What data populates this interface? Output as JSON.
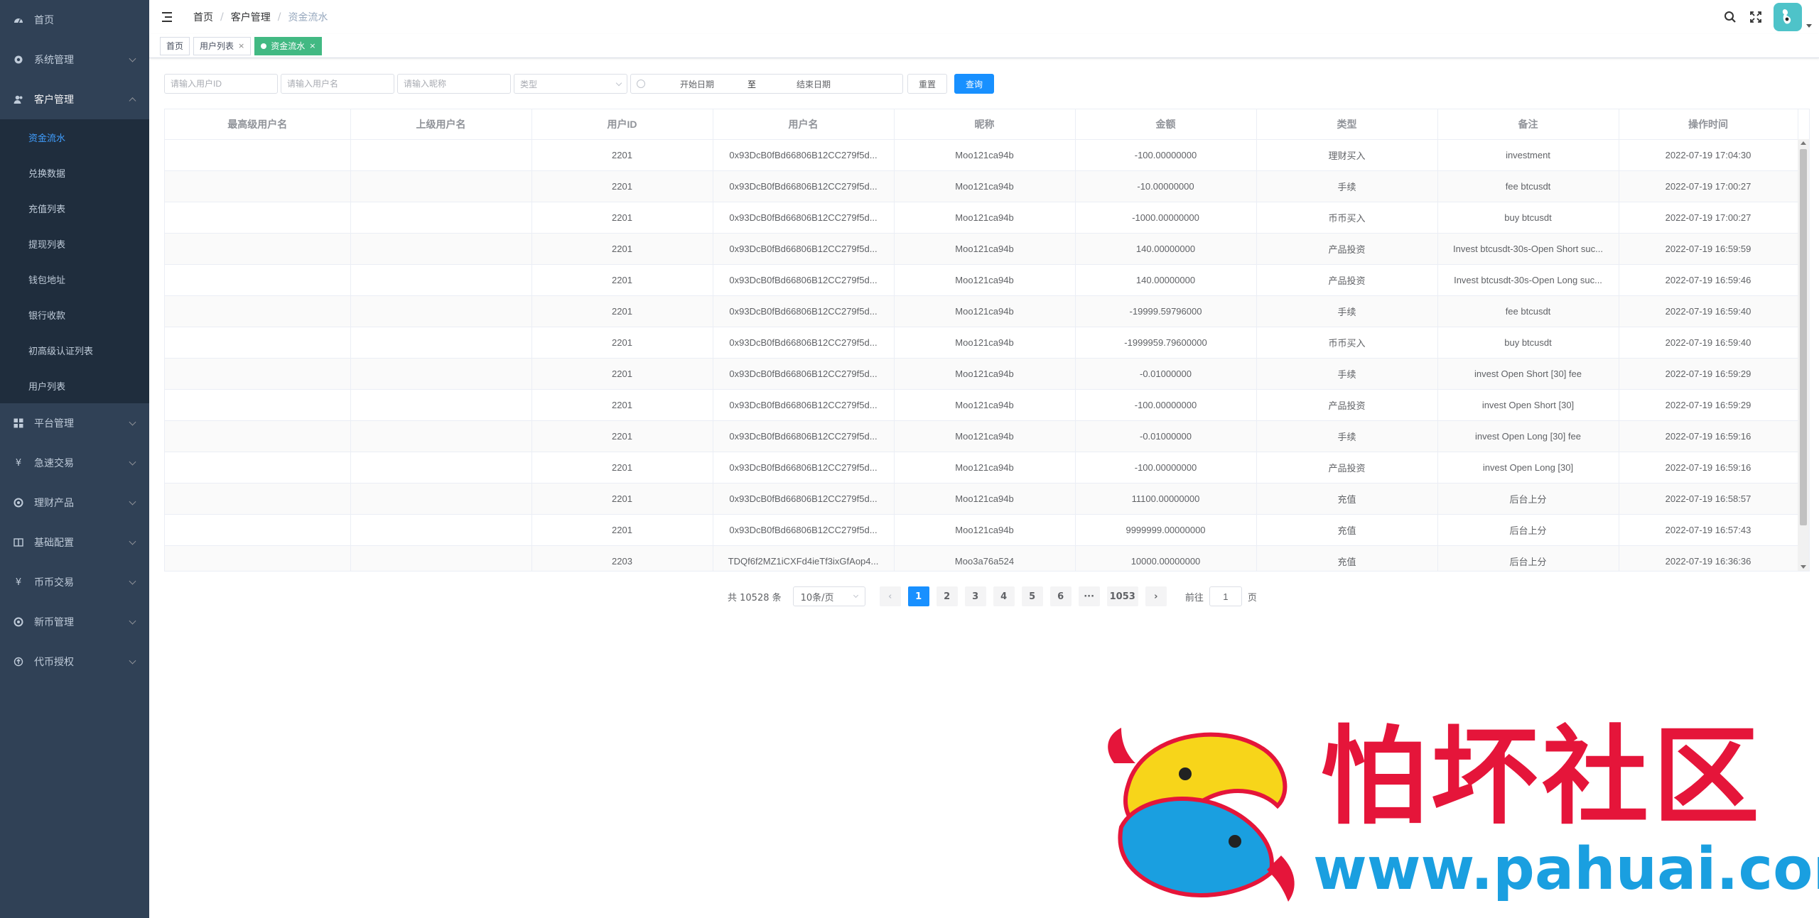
{
  "sidebar": {
    "items": [
      {
        "label": "首页",
        "icon": "dashboard-icon"
      },
      {
        "label": "系统管理",
        "icon": "gear-icon"
      },
      {
        "label": "客户管理",
        "icon": "users-icon"
      },
      {
        "label": "平台管理",
        "icon": "grid-icon"
      },
      {
        "label": "急速交易",
        "icon": "yen-icon"
      },
      {
        "label": "理财产品",
        "icon": "target-icon"
      },
      {
        "label": "基础配置",
        "icon": "book-icon"
      },
      {
        "label": "币币交易",
        "icon": "yen-icon"
      },
      {
        "label": "新币管理",
        "icon": "target-icon"
      },
      {
        "label": "代币授权",
        "icon": "circle-up-icon"
      }
    ],
    "submenu": [
      "资金流水",
      "兑换数据",
      "充值列表",
      "提现列表",
      "钱包地址",
      "银行收款",
      "初高级认证列表",
      "用户列表"
    ]
  },
  "navbar": {
    "breadcrumb": [
      "首页",
      "客户管理",
      "资金流水"
    ],
    "breadcrumb_sep": "/"
  },
  "tags": [
    {
      "label": "首页"
    },
    {
      "label": "用户列表"
    },
    {
      "label": "资金流水"
    }
  ],
  "tag_close": "×",
  "filters": {
    "user_id_placeholder": "请输入用户ID",
    "username_placeholder": "请输入用户名",
    "nickname_placeholder": "请输入昵称",
    "type_placeholder": "类型",
    "start_date": "开始日期",
    "date_sep": "至",
    "end_date": "结束日期",
    "reset_label": "重置",
    "query_label": "查询"
  },
  "table": {
    "columns": [
      "最高级用户名",
      "上级用户名",
      "用户ID",
      "用户名",
      "昵称",
      "金额",
      "类型",
      "备注",
      "操作时间"
    ],
    "rows": [
      [
        "",
        "",
        "2201",
        "0x93DcB0fBd66806B12CC279f5d...",
        "Moo121ca94b",
        "-100.00000000",
        "理财买入",
        "investment",
        "2022-07-19 17:04:30"
      ],
      [
        "",
        "",
        "2201",
        "0x93DcB0fBd66806B12CC279f5d...",
        "Moo121ca94b",
        "-10.00000000",
        "手续",
        "fee btcusdt",
        "2022-07-19 17:00:27"
      ],
      [
        "",
        "",
        "2201",
        "0x93DcB0fBd66806B12CC279f5d...",
        "Moo121ca94b",
        "-1000.00000000",
        "币币买入",
        "buy btcusdt",
        "2022-07-19 17:00:27"
      ],
      [
        "",
        "",
        "2201",
        "0x93DcB0fBd66806B12CC279f5d...",
        "Moo121ca94b",
        "140.00000000",
        "产品投资",
        "Invest btcusdt-30s-Open Short suc...",
        "2022-07-19 16:59:59"
      ],
      [
        "",
        "",
        "2201",
        "0x93DcB0fBd66806B12CC279f5d...",
        "Moo121ca94b",
        "140.00000000",
        "产品投资",
        "Invest btcusdt-30s-Open Long suc...",
        "2022-07-19 16:59:46"
      ],
      [
        "",
        "",
        "2201",
        "0x93DcB0fBd66806B12CC279f5d...",
        "Moo121ca94b",
        "-19999.59796000",
        "手续",
        "fee btcusdt",
        "2022-07-19 16:59:40"
      ],
      [
        "",
        "",
        "2201",
        "0x93DcB0fBd66806B12CC279f5d...",
        "Moo121ca94b",
        "-1999959.79600000",
        "币币买入",
        "buy btcusdt",
        "2022-07-19 16:59:40"
      ],
      [
        "",
        "",
        "2201",
        "0x93DcB0fBd66806B12CC279f5d...",
        "Moo121ca94b",
        "-0.01000000",
        "手续",
        "invest Open Short [30] fee",
        "2022-07-19 16:59:29"
      ],
      [
        "",
        "",
        "2201",
        "0x93DcB0fBd66806B12CC279f5d...",
        "Moo121ca94b",
        "-100.00000000",
        "产品投资",
        "invest Open Short [30]",
        "2022-07-19 16:59:29"
      ],
      [
        "",
        "",
        "2201",
        "0x93DcB0fBd66806B12CC279f5d...",
        "Moo121ca94b",
        "-0.01000000",
        "手续",
        "invest Open Long [30] fee",
        "2022-07-19 16:59:16"
      ],
      [
        "",
        "",
        "2201",
        "0x93DcB0fBd66806B12CC279f5d...",
        "Moo121ca94b",
        "-100.00000000",
        "产品投资",
        "invest Open Long [30]",
        "2022-07-19 16:59:16"
      ],
      [
        "",
        "",
        "2201",
        "0x93DcB0fBd66806B12CC279f5d...",
        "Moo121ca94b",
        "11100.00000000",
        "充值",
        "后台上分",
        "2022-07-19 16:58:57"
      ],
      [
        "",
        "",
        "2201",
        "0x93DcB0fBd66806B12CC279f5d...",
        "Moo121ca94b",
        "9999999.00000000",
        "充值",
        "后台上分",
        "2022-07-19 16:57:43"
      ],
      [
        "",
        "",
        "2203",
        "TDQf6f2MZ1iCXFd4ieTf3ixGfAop4...",
        "Moo3a76a524",
        "10000.00000000",
        "充值",
        "后台上分",
        "2022-07-19 16:36:36"
      ]
    ]
  },
  "pagination": {
    "total": "共 10528 条",
    "page_size": "10条/页",
    "prev": "‹",
    "next": "›",
    "pages": [
      "1",
      "2",
      "3",
      "4",
      "5",
      "6",
      "···",
      "1053"
    ],
    "current": "1",
    "goto_prefix": "前往",
    "goto_value": "1",
    "goto_suffix": "页"
  },
  "watermark": {
    "chinese": "怕坏社区",
    "url": "www.pahuai.com"
  },
  "colors": {
    "sidebar_bg": "#304156",
    "submenu_bg": "#1f2d3d",
    "active_link": "#409eff",
    "primary": "#1890ff",
    "tag_active": "#42b983",
    "avatar": "#4ec3c9",
    "watermark_red": "#e5153a",
    "watermark_blue": "#1a9fe0"
  }
}
